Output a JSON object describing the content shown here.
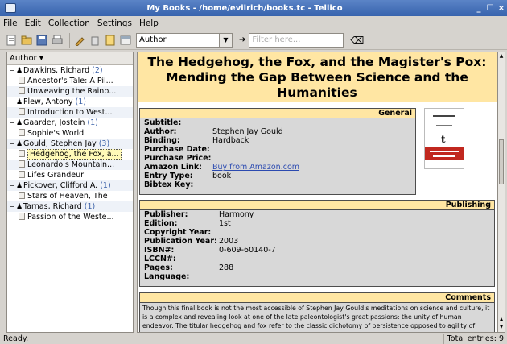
{
  "window": {
    "title": "My Books - /home/evilrich/books.tc - Tellico",
    "controls": [
      "_",
      "☐",
      "×"
    ]
  },
  "menu": [
    "File",
    "Edit",
    "Collection",
    "Settings",
    "Help"
  ],
  "toolbar": {
    "group_by": "Author",
    "filter_label": "Filter here...",
    "filter_placeholder": "Filter here..."
  },
  "tree": {
    "header": "Author",
    "authors": [
      {
        "name": "Dawkins, Richard",
        "count": "(2)",
        "books": [
          "Ancestor's Tale: A Pil...",
          "Unweaving the Rainb..."
        ]
      },
      {
        "name": "Flew, Antony",
        "count": "(1)",
        "books": [
          "Introduction to West..."
        ]
      },
      {
        "name": "Gaarder, Jostein",
        "count": "(1)",
        "books": [
          "Sophie's World"
        ]
      },
      {
        "name": "Gould, Stephen Jay",
        "count": "(3)",
        "books": [
          "Hedgehog, the Fox, a...",
          "Leonardo's Mountain...",
          "Lifes Grandeur"
        ]
      },
      {
        "name": "Pickover, Clifford A.",
        "count": "(1)",
        "books": [
          "Stars of Heaven, The"
        ]
      },
      {
        "name": "Tarnas, Richard",
        "count": "(1)",
        "books": [
          "Passion of the Weste..."
        ]
      }
    ]
  },
  "entry": {
    "title": "The Hedgehog, the Fox, and the Magister's Pox: Mending the Gap Between Science and the Humanities",
    "general": {
      "header": "General",
      "fields": [
        {
          "label": "Subtitle:",
          "value": ""
        },
        {
          "label": "Author:",
          "value": "Stephen Jay Gould"
        },
        {
          "label": "Binding:",
          "value": "Hardback"
        },
        {
          "label": "Purchase Date:",
          "value": ""
        },
        {
          "label": "Purchase Price:",
          "value": ""
        },
        {
          "label": "Amazon Link:",
          "value": "Buy from Amazon.com"
        },
        {
          "label": "Entry Type:",
          "value": "book"
        },
        {
          "label": "Bibtex Key:",
          "value": ""
        }
      ]
    },
    "publishing": {
      "header": "Publishing",
      "fields": [
        {
          "label": "Publisher:",
          "value": "Harmony"
        },
        {
          "label": "Edition:",
          "value": "1st"
        },
        {
          "label": "Copyright Year:",
          "value": ""
        },
        {
          "label": "Publication Year:",
          "value": "2003"
        },
        {
          "label": "ISBN#:",
          "value": "0-609-60140-7"
        },
        {
          "label": "LCCN#:",
          "value": ""
        },
        {
          "label": "Pages:",
          "value": "288"
        },
        {
          "label": "Language:",
          "value": ""
        }
      ]
    },
    "comments": {
      "header": "Comments",
      "text": "Though this final book is not the most accessible of Stephen Jay Gould's meditations on science and culture, it is a complex and revealing look at one of the late paleontologist's great passions: the unity of human endeavor. The titular hedgehog and fox refer to the classic dichotomy of persistence opposed to agility of thought, which Gould uses as a backbone in comparing, contrasting, and"
    }
  },
  "status": {
    "message": "Ready.",
    "total": "Total entries: 9"
  },
  "colors": {
    "title_bg": "#ffe6a3",
    "section_bg": "#d8d8d8",
    "titlebar": "#3763ad",
    "selection": "#fff9b8"
  }
}
